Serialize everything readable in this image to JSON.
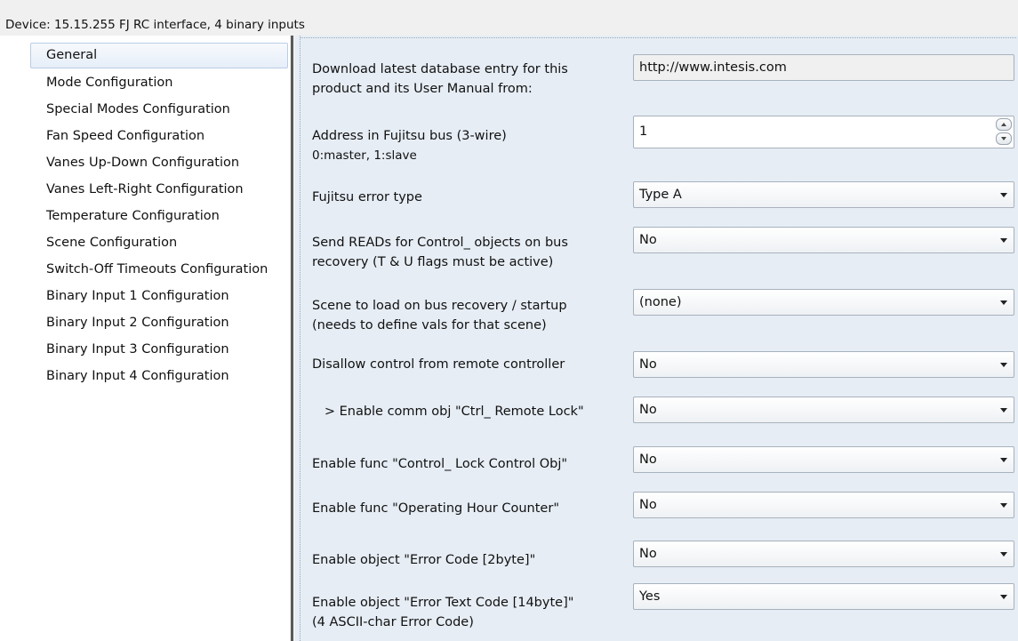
{
  "header": {
    "device_label": "Device: 15.15.255  FJ RC interface, 4 binary inputs"
  },
  "sidebar": {
    "items": [
      {
        "label": "General",
        "selected": true
      },
      {
        "label": "Mode Configuration"
      },
      {
        "label": "Special Modes Configuration"
      },
      {
        "label": "Fan Speed Configuration"
      },
      {
        "label": "Vanes Up-Down Configuration"
      },
      {
        "label": "Vanes Left-Right Configuration"
      },
      {
        "label": "Temperature Configuration"
      },
      {
        "label": "Scene Configuration"
      },
      {
        "label": "Switch-Off Timeouts Configuration"
      },
      {
        "label": "Binary Input 1 Configuration"
      },
      {
        "label": "Binary Input 2 Configuration"
      },
      {
        "label": "Binary Input 3 Configuration"
      },
      {
        "label": "Binary Input 4 Configuration"
      }
    ]
  },
  "params": [
    {
      "label_1": "Download latest database entry for this",
      "label_2": "product and its User Manual from:",
      "type": "text",
      "value": "http://www.intesis.com"
    },
    {
      "label_1": "Address in Fujitsu bus (3-wire)",
      "label_2": "0:master, 1:slave",
      "type": "spin",
      "value": "1"
    },
    {
      "label_1": "Fujitsu error type",
      "type": "select",
      "value": "Type A"
    },
    {
      "label_1": "Send READs for Control_ objects on bus",
      "label_2": "recovery (T & U flags must be active)",
      "type": "select",
      "value": "No"
    },
    {
      "label_1": "Scene to load on bus recovery / startup",
      "label_2": "(needs to define vals for that scene)",
      "type": "select",
      "value": "(none)"
    },
    {
      "label_1": "Disallow control from remote controller",
      "type": "select",
      "value": "No"
    },
    {
      "label_1": "   > Enable comm obj \"Ctrl_ Remote Lock\"",
      "type": "select",
      "value": "No"
    },
    {
      "label_1": "Enable func \"Control_ Lock Control Obj\"",
      "type": "select",
      "value": "No"
    },
    {
      "label_1": "Enable func \"Operating Hour Counter\"",
      "type": "select",
      "value": "No"
    },
    {
      "label_1": "Enable object \"Error Code [2byte]\"",
      "type": "select",
      "value": "No"
    },
    {
      "label_1": "Enable object \"Error Text Code [14byte]\"",
      "label_2": "(4 ASCII-char Error Code)",
      "type": "select",
      "value": "Yes"
    }
  ],
  "colors": {
    "panel_bg": "#e6edf5",
    "selected_bg": "#e6eef8",
    "splitter": "#5a5a5a"
  }
}
